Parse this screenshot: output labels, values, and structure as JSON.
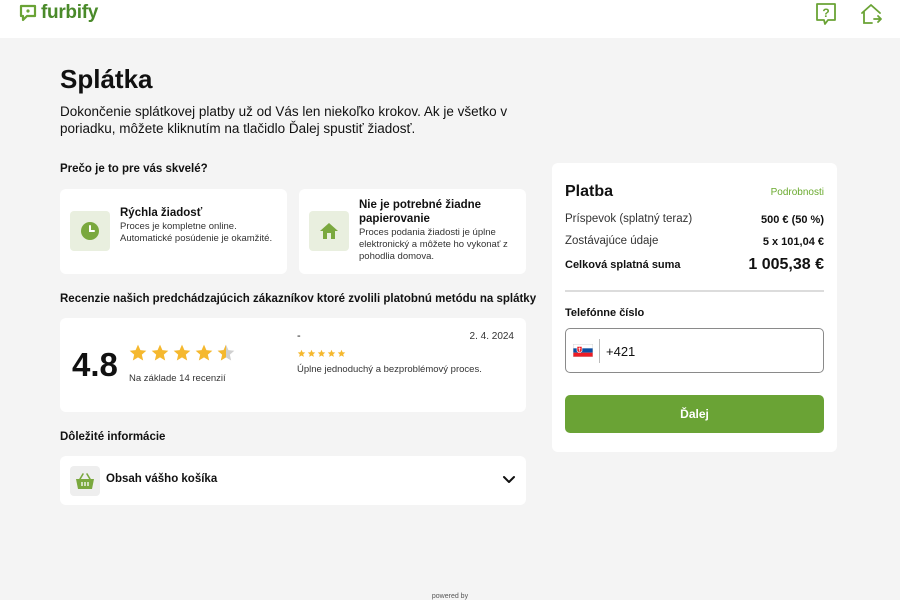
{
  "header": {
    "logo_text": "furbify",
    "help_icon": "help-icon",
    "home_icon": "home-exit-icon"
  },
  "main": {
    "title": "Splátka",
    "intro": "Dokončenie splátkovej platby už od Vás len niekoľko krokov. Ak je všetko v poriadku, môžete kliknutím na tlačidlo Ďalej spustiť žiadosť.",
    "why_title": "Prečo je to pre vás skvelé?",
    "benefits": [
      {
        "icon": "clock-icon",
        "title": "Rýchla žiadosť",
        "desc": "Proces je kompletne online. Automatické posúdenie je okamžité."
      },
      {
        "icon": "home-icon",
        "title": "Nie je potrebné žiadne papierovanie",
        "desc": "Proces podania žiadosti je úplne elektronický a môžete ho vykonať z pohodlia domova."
      }
    ],
    "reviews_title": "Recenzie našich predchádzajúcich zákazníkov ktoré zvolili platobnú metódu na splátky",
    "reviews": {
      "rating": "4.8",
      "rating_stars": 4.8,
      "count_text": "Na základe 14 recenzií",
      "latest": {
        "author": "-",
        "date": "2. 4. 2024",
        "stars": 5,
        "text": "Úplne jednoduchý a bezproblémový proces."
      }
    },
    "info_title": "Dôležité informácie",
    "basket_label": "Obsah vášho košíka"
  },
  "panel": {
    "title": "Platba",
    "details_link": "Podrobnosti",
    "rows": [
      {
        "label": "Príspevok (splatný teraz)",
        "value": "500 € (50 %)"
      },
      {
        "label": "Zostávajúce údaje",
        "value": "5 x 101,04 €"
      }
    ],
    "total_label": "Celková splatná suma",
    "total_value": "1 005,38 €",
    "phone_label": "Telefónne číslo",
    "phone_value": "+421",
    "next_label": "Ďalej"
  },
  "footer": {
    "powered_by": "powered by"
  },
  "colors": {
    "accent": "#6aa335",
    "star": "#f5b82e",
    "icon_green": "#7aa83e"
  }
}
